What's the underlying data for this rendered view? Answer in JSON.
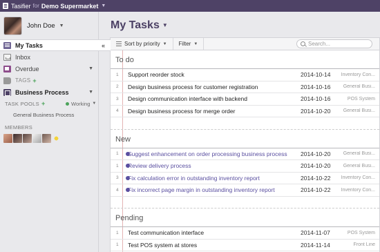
{
  "topbar": {
    "app_name": "Tasifier",
    "for_label": "for",
    "workspace": "Demo Supermarket"
  },
  "profile": {
    "name": "John Doe"
  },
  "nav": {
    "my_tasks": "My Tasks",
    "collapse": "«",
    "inbox": "Inbox",
    "overdue": "Overdue",
    "tags": "TAGS",
    "business_process": "Business Process"
  },
  "task_pools": {
    "label": "TASK POOLS",
    "status": "Working",
    "items": [
      "General Business Process"
    ]
  },
  "members": {
    "label": "MEMBERS"
  },
  "main": {
    "title": "My Tasks",
    "sort_label": "Sort by priority",
    "filter_label": "Filter",
    "search_placeholder": "Search..."
  },
  "sections": [
    {
      "title": "To do",
      "rows": [
        {
          "num": "1",
          "title": "Support reorder stock",
          "date": "2014-10-14",
          "pool": "Inventory Con..."
        },
        {
          "num": "2",
          "title": "Design business process for customer registration",
          "date": "2014-10-16",
          "pool": "General Busi..."
        },
        {
          "num": "3",
          "title": "Design communication interface with backend",
          "date": "2014-10-16",
          "pool": "POS System"
        },
        {
          "num": "4",
          "title": "Design business process for merge order",
          "date": "2014-10-20",
          "pool": "General Busi..."
        }
      ]
    },
    {
      "title": "New",
      "rows": [
        {
          "num": "1",
          "title": "Suggest enhancement on order processing business process",
          "date": "2014-10-20",
          "pool": "General Busi..."
        },
        {
          "num": "1",
          "title": "Review delivery process",
          "date": "2014-10-20",
          "pool": "General Busi..."
        },
        {
          "num": "3",
          "title": "Fix calculation error in outstanding inventory report",
          "date": "2014-10-22",
          "pool": "Inventory Con..."
        },
        {
          "num": "4",
          "title": "Fix incorrect page margin in outstanding inventory report",
          "date": "2014-10-22",
          "pool": "Inventory Con..."
        }
      ]
    },
    {
      "title": "Pending",
      "rows": [
        {
          "num": "1",
          "title": "Test communication interface",
          "date": "2014-11-07",
          "pool": "POS System"
        },
        {
          "num": "1",
          "title": "Test POS system at stores",
          "date": "2014-11-14",
          "pool": "Front Line"
        }
      ]
    }
  ]
}
